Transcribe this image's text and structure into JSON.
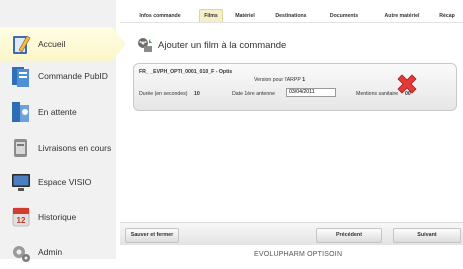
{
  "sidebar": {
    "items": [
      {
        "label": "Accueil",
        "icon": "pencil-icon",
        "active": true
      },
      {
        "label": "Commande PubID",
        "icon": "orders-icon"
      },
      {
        "label": "En attente",
        "icon": "waiting-icon"
      },
      {
        "label": "Livraisons en cours",
        "icon": "delivery-icon"
      },
      {
        "label": "Espace VISIO",
        "icon": "monitor-icon"
      },
      {
        "label": "Historique",
        "icon": "calendar-icon"
      },
      {
        "label": "Admin",
        "icon": "gears-icon"
      }
    ]
  },
  "tabs": [
    {
      "label": "Infos commande"
    },
    {
      "label": "Films",
      "active": true
    },
    {
      "label": "Matériel"
    },
    {
      "label": "Destinations"
    },
    {
      "label": "Documents"
    },
    {
      "label": "Autre matériel"
    },
    {
      "label": "Récap"
    }
  ],
  "main": {
    "title": "Ajouter un film à la commande",
    "film": {
      "reference": "FR_      _EVPH_OPTI_0001_010_F  - Optis",
      "version_label": "Version pour l'ARPP",
      "version_value": "1",
      "duration_label": "Durée (en secondes)",
      "duration_value": "10",
      "date_label": "Date 1ère antenne",
      "date_value": "03/04/2011",
      "mentions_label": "Mentions sanitaire",
      "mentions_value": "00"
    }
  },
  "bottom": {
    "save_close": "Sauver et fermer",
    "previous": "Précédent",
    "next": "Suivant"
  },
  "footer": "EVOLUPHARM OPTISOIN",
  "colors": {
    "active_nav": "#fbf6c8",
    "delete": "#e53935"
  }
}
